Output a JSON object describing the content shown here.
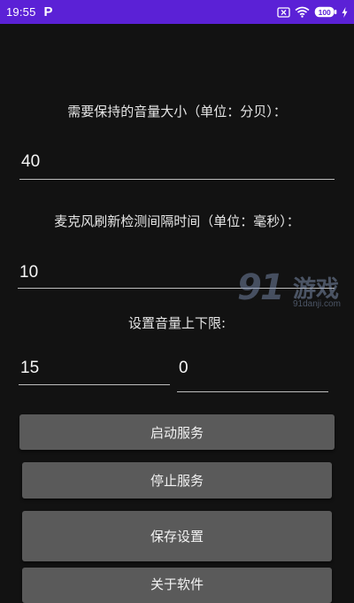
{
  "status_bar": {
    "time": "19:55",
    "app_icon_letter": "P",
    "battery": "100",
    "icons": [
      "sim-x-icon",
      "wifi-icon",
      "battery-icon",
      "charging-bolt-icon"
    ]
  },
  "volume_setting": {
    "label": "需要保持的音量大小（单位：分贝）：",
    "value": "40"
  },
  "refresh_interval": {
    "label": "麦克风刷新检测间隔时间（单位：毫秒）：",
    "value": "10"
  },
  "volume_limits": {
    "label": "设置音量上下限:",
    "upper_value": "15",
    "lower_value": "0"
  },
  "buttons": {
    "start": "启动服务",
    "stop": "停止服务",
    "save": "保存设置",
    "about": "关于软件"
  },
  "watermark": {
    "logo_number": "91",
    "logo_text": "游戏",
    "url": "91danji.com"
  },
  "colors": {
    "status_bar": "#5b21d6",
    "background": "#121212",
    "button": "#5a5a5a"
  }
}
